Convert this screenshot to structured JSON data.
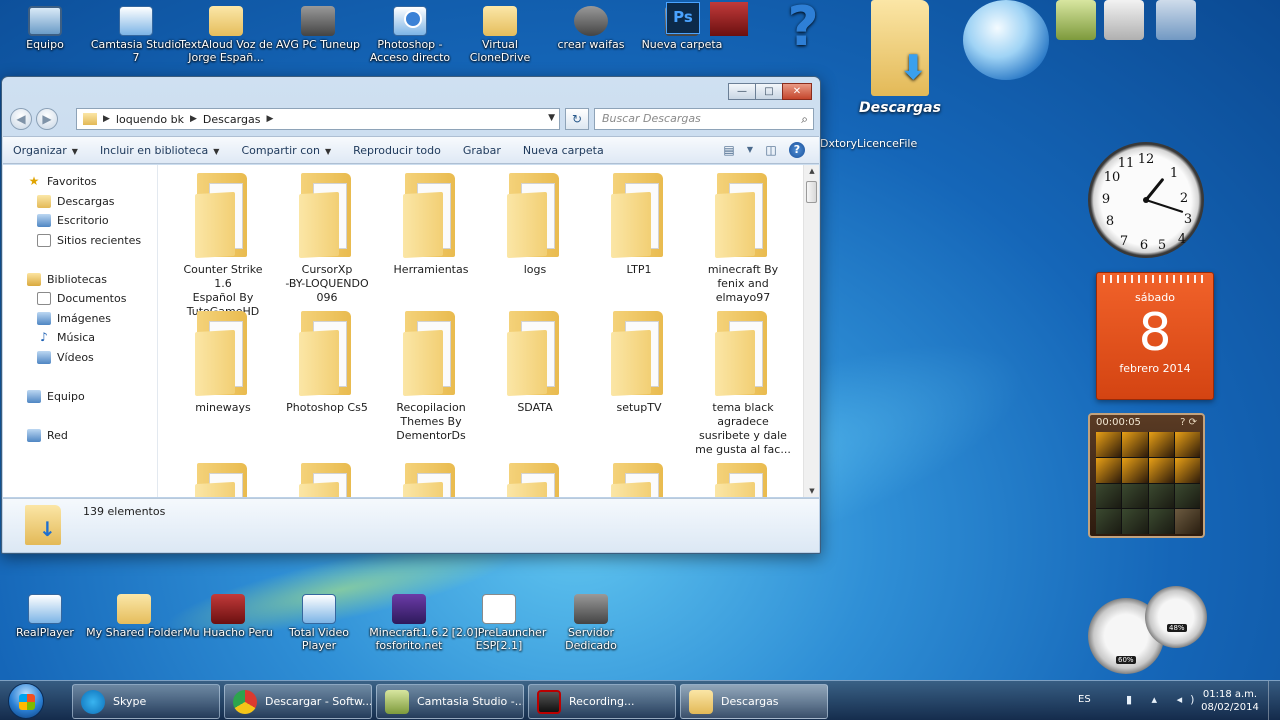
{
  "desktop_icons_top": [
    {
      "label": "Equipo",
      "icon": "computer-icon"
    },
    {
      "label": "Camtasia Studio 7",
      "icon": "camtasia-icon"
    },
    {
      "label": "TextAloud  Voz de Jorge Españ...",
      "icon": "textaloud-icon"
    },
    {
      "label": "AVG PC Tuneup",
      "icon": "avg-icon"
    },
    {
      "label": "Photoshop - Acceso directo",
      "icon": "photoshop-shortcut-icon"
    },
    {
      "label": "Virtual CloneDrive",
      "icon": "clonedrive-icon"
    },
    {
      "label": "crear waifas",
      "icon": "app-icon"
    },
    {
      "label": "Nueva carpeta",
      "icon": "folder-icon"
    }
  ],
  "ps_icon_text": "Ps",
  "desktop_icons_bottom": [
    {
      "label": "RealPlayer",
      "icon": "realplayer-icon"
    },
    {
      "label": "My Shared Folder",
      "icon": "folder-icon"
    },
    {
      "label": "Mu Huacho Peru",
      "icon": "game-icon"
    },
    {
      "label": "Total Video Player",
      "icon": "video-player-icon"
    },
    {
      "label": "Minecraft1.6.2 fosforito.net",
      "icon": "winrar-icon"
    },
    {
      "label": "[2.0]PreLauncher ESP[2.1]",
      "icon": "file-icon"
    },
    {
      "label": "Servidor Dedicado",
      "icon": "counter-strike-icon"
    }
  ],
  "right_desktop": {
    "big_folder_label": "Descargas",
    "dxtory_label": "DxtoryLicenceFile"
  },
  "explorer": {
    "window_controls": {
      "minimize": "—",
      "maximize": "□",
      "close": "✕"
    },
    "address": {
      "crumbs": [
        "loquendo bk",
        "Descargas"
      ]
    },
    "search_placeholder": "Buscar Descargas",
    "toolbar": {
      "organize": "Organizar",
      "include_library": "Incluir en biblioteca",
      "share_with": "Compartir con",
      "play_all": "Reproducir todo",
      "burn": "Grabar",
      "new_folder": "Nueva carpeta"
    },
    "nav_pane": {
      "favorites": "Favoritos",
      "favorites_items": [
        "Descargas",
        "Escritorio",
        "Sitios recientes"
      ],
      "libraries": "Bibliotecas",
      "library_items": [
        "Documentos",
        "Imágenes",
        "Música",
        "Vídeos"
      ],
      "computer": "Equipo",
      "network": "Red"
    },
    "files": [
      [
        "Counter Strike 1.6",
        "Español By",
        "TutoGameHD"
      ],
      [
        "CursorXp",
        "-BY-LOQUENDO",
        "096"
      ],
      [
        "Herramientas"
      ],
      [
        "logs"
      ],
      [
        "LTP1"
      ],
      [
        "minecraft By",
        "fenix and",
        "elmayo97"
      ],
      [
        "mineways"
      ],
      [
        "Photoshop Cs5"
      ],
      [
        "Recopilacion",
        "Themes By",
        "DementorDs"
      ],
      [
        "SDATA"
      ],
      [
        "setupTV"
      ],
      [
        "tema black",
        "agradece",
        "susribete y dale",
        "me gusta al fac..."
      ]
    ],
    "status": "139 elementos"
  },
  "gadgets": {
    "clock": {
      "hour": 1,
      "minute": 18
    },
    "calendar": {
      "day_of_week": "sábado",
      "day": "8",
      "month_year": "febrero 2014"
    },
    "puzzle_timer": "00:00:05",
    "meters": {
      "cpu": "60%",
      "ram": "48%"
    }
  },
  "taskbar": {
    "buttons": [
      {
        "label": "Skype",
        "icon": "skype-icon"
      },
      {
        "label": "Descargar - Softw...",
        "icon": "chrome-icon"
      },
      {
        "label": "Camtasia Studio -...",
        "icon": "camtasia-icon"
      },
      {
        "label": "Recording...",
        "icon": "recording-icon"
      },
      {
        "label": "Descargas",
        "icon": "folder-icon"
      }
    ],
    "language": "ES",
    "time": "01:18 a.m.",
    "date": "08/02/2014"
  }
}
